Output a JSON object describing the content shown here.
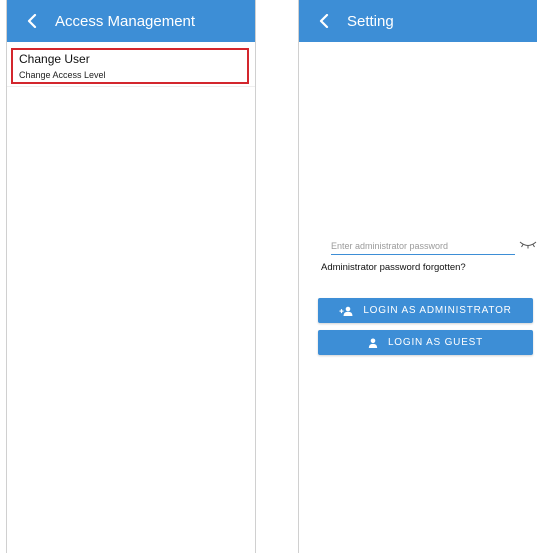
{
  "colors": {
    "appbar": "#3d8ed6",
    "button": "#3d8ed6",
    "highlight_border": "#d3262d",
    "input_underline": "#3d8ed6"
  },
  "left_screen": {
    "appbar": {
      "back_icon": "chevron-left-icon",
      "title": "Access Management"
    },
    "list": {
      "items": [
        {
          "title": "Change User",
          "subtitle": "Change Access Level"
        }
      ]
    }
  },
  "right_screen": {
    "appbar": {
      "back_icon": "chevron-left-icon",
      "title": "Setting"
    },
    "password": {
      "value": "",
      "placeholder": "Enter administrator password",
      "toggle_icon": "eye-closed-icon"
    },
    "forgot_link": "Administrator password forgotten?",
    "buttons": {
      "admin": {
        "icon": "user-key-icon",
        "label": "LOGIN AS ADMINISTRATOR"
      },
      "guest": {
        "icon": "person-icon",
        "label": "LOGIN AS GUEST"
      }
    }
  }
}
